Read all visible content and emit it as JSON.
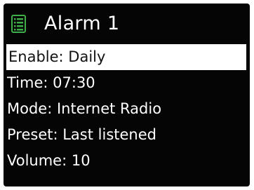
{
  "header": {
    "icon": "alarm-list-icon",
    "title": "Alarm 1"
  },
  "menu": {
    "items": [
      {
        "label": "Enable: Daily",
        "selected": true
      },
      {
        "label": "Time: 07:30",
        "selected": false
      },
      {
        "label": "Mode: Internet Radio",
        "selected": false
      },
      {
        "label": "Preset: Last listened",
        "selected": false
      },
      {
        "label": "Volume: 10",
        "selected": false
      }
    ]
  },
  "colors": {
    "screen_background": "#050505",
    "text": "#ffffff",
    "highlight_background": "#ffffff",
    "highlight_text": "#111111",
    "icon_green": "#3fae49"
  }
}
